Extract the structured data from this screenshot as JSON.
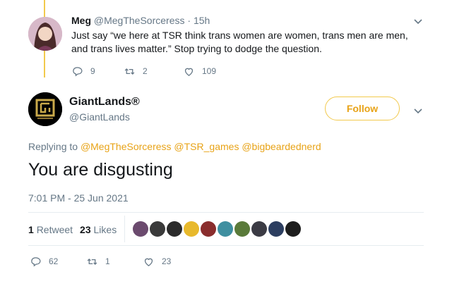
{
  "parent_tweet": {
    "display_name": "Meg",
    "handle": "@MegTheSorceress",
    "separator": "·",
    "time": "15h",
    "text": "Just say “we here at TSR think trans women are women, trans men are men, and trans lives matter.” Stop trying to dodge the question.",
    "actions": {
      "replies": "9",
      "retweets": "2",
      "likes": "109"
    }
  },
  "main_tweet": {
    "display_name": "GiantLands®",
    "handle": "@GiantLands",
    "follow_label": "Follow",
    "replying_prefix": "Replying to",
    "reply_mentions": [
      "@MegTheSorceress",
      "@TSR_games",
      "@bigbeardednerd"
    ],
    "text": "You are disgusting",
    "timestamp": "7:01 PM - 25 Jun 2021",
    "stats": {
      "retweets_count": "1",
      "retweets_label": "Retweet",
      "likes_count": "23",
      "likes_label": "Likes"
    },
    "liker_avatar_colors": [
      "#6b4a6e",
      "#3a3a3a",
      "#2b2b2b",
      "#e8b92c",
      "#8a2d2d",
      "#3f8fa0",
      "#5a7a3a",
      "#3b3b44",
      "#2c3e60",
      "#1d1d1d"
    ],
    "actions": {
      "replies": "62",
      "retweets": "1",
      "likes": "23"
    }
  },
  "colors": {
    "accent": "#e8a317",
    "thread_line": "#f2c94c",
    "muted": "#657786",
    "text": "#14171a"
  }
}
